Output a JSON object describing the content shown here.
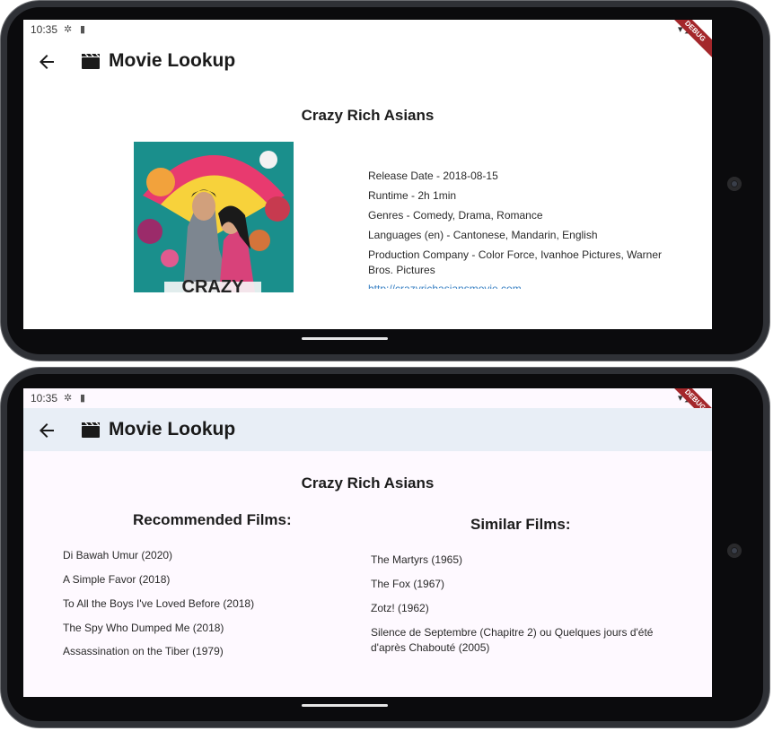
{
  "status": {
    "time": "10:35"
  },
  "debug_label": "DEBUG",
  "app": {
    "title": "Movie Lookup"
  },
  "movie": {
    "title": "Crazy Rich Asians",
    "poster_caption": "CRAZY",
    "details": {
      "release": "Release Date - 2018-08-15",
      "runtime": "Runtime - 2h 1min",
      "genres": "Genres - Comedy, Drama, Romance",
      "languages": "Languages (en) - Cantonese, Mandarin, English",
      "production": "Production Company - Color Force, Ivanhoe Pictures, Warner Bros. Pictures",
      "homepage": "http://crazyrichasiansmovie.com"
    }
  },
  "recommended": {
    "heading": "Recommended Films:",
    "items": [
      "Di Bawah Umur (2020)",
      "A Simple Favor (2018)",
      "To All the Boys I've Loved Before (2018)",
      "The Spy Who Dumped Me (2018)",
      "Assassination on the Tiber (1979)"
    ]
  },
  "similar": {
    "heading": "Similar Films:",
    "items": [
      "The Martyrs (1965)",
      "The Fox (1967)",
      "Zotz! (1962)",
      "Silence de Septembre (Chapitre 2) ou Quelques jours d'été d'après Chabouté (2005)"
    ]
  },
  "colors": {
    "appbar_bg_2": "#e8eef6",
    "link": "#3b82c4",
    "debug_banner": "#a4272b"
  }
}
